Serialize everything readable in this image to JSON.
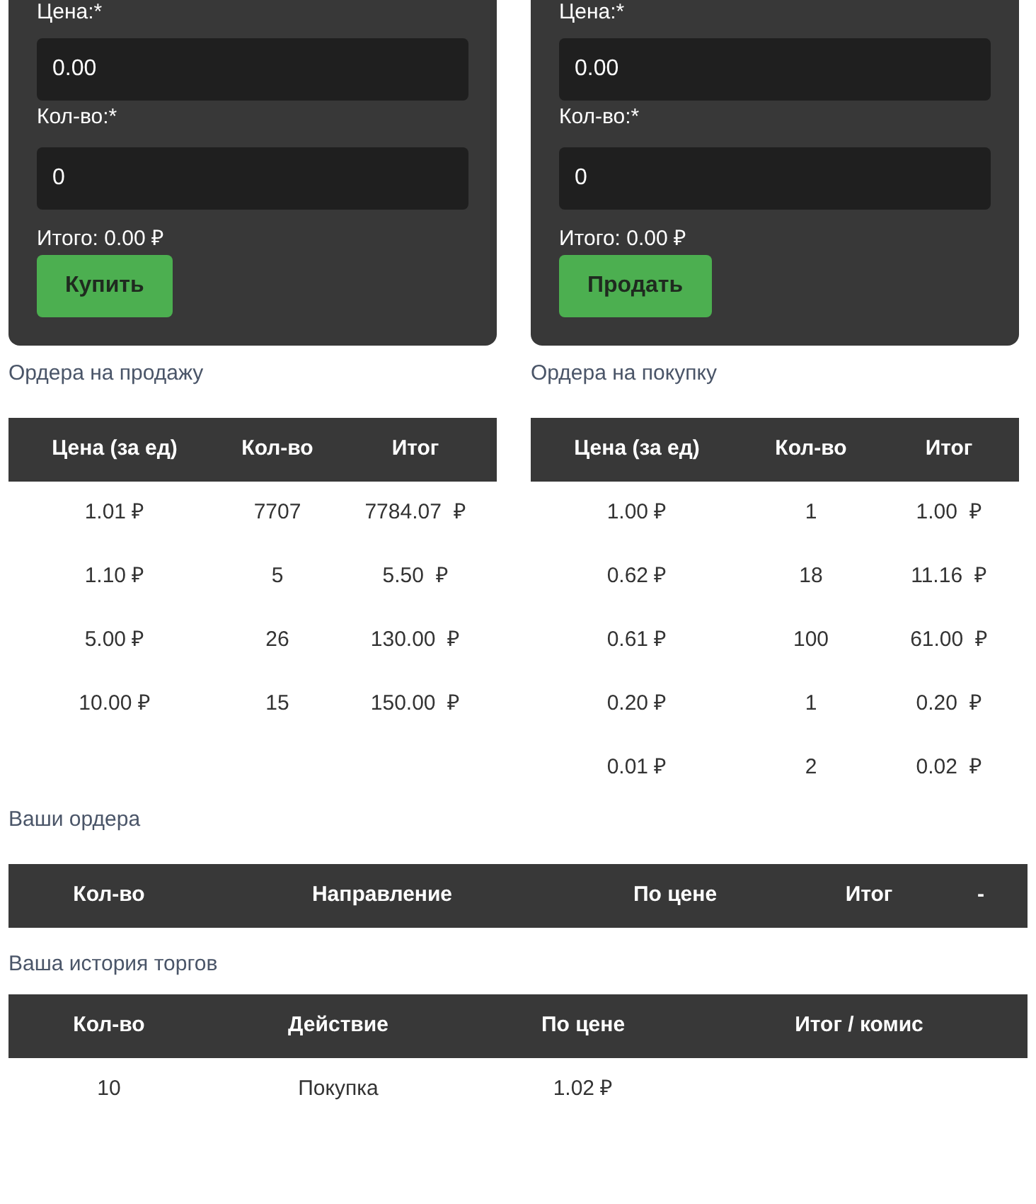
{
  "trade_forms": [
    {
      "price_label": "Цена:*",
      "price_value": "0.00",
      "qty_label": "Кол-во:*",
      "qty_value": "0",
      "total": "Итого: 0.00 ₽",
      "button": "Купить"
    },
    {
      "price_label": "Цена:*",
      "price_value": "0.00",
      "qty_label": "Кол-во:*",
      "qty_value": "0",
      "total": "Итого: 0.00 ₽",
      "button": "Продать"
    }
  ],
  "order_books": [
    {
      "title": "Ордера на продажу",
      "columns": [
        "Цена (за ед)",
        "Кол-во",
        "Итог"
      ],
      "rows": [
        [
          "1.01 ₽",
          "7707",
          "7784.07  ₽"
        ],
        [
          "1.10 ₽",
          "5",
          "5.50  ₽"
        ],
        [
          "5.00 ₽",
          "26",
          "130.00  ₽"
        ],
        [
          "10.00 ₽",
          "15",
          "150.00  ₽"
        ]
      ]
    },
    {
      "title": "Ордера на покупку",
      "columns": [
        "Цена (за ед)",
        "Кол-во",
        "Итог"
      ],
      "rows": [
        [
          "1.00 ₽",
          "1",
          "1.00  ₽"
        ],
        [
          "0.62 ₽",
          "18",
          "11.16  ₽"
        ],
        [
          "0.61 ₽",
          "100",
          "61.00  ₽"
        ],
        [
          "0.20 ₽",
          "1",
          "0.20  ₽"
        ],
        [
          "0.01 ₽",
          "2",
          "0.02  ₽"
        ]
      ]
    }
  ],
  "my_orders": {
    "title": "Ваши ордера",
    "columns": [
      "Кол-во",
      "Направление",
      "По цене",
      "Итог",
      "-"
    ]
  },
  "trade_history": {
    "title": "Ваша история торгов",
    "columns": [
      "Кол-во",
      "Действие",
      "По цене",
      "Итог / комис"
    ],
    "rows": [
      [
        "10",
        "Покупка",
        "1.02 ₽"
      ]
    ]
  }
}
